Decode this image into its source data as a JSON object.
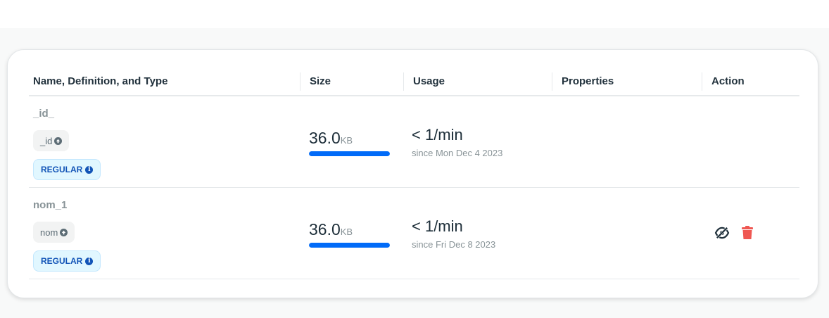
{
  "table": {
    "headers": [
      "Name, Definition, and Type",
      "Size",
      "Usage",
      "Properties",
      "Action"
    ],
    "rows": [
      {
        "name": "_id_",
        "field": "_id",
        "field_icon": "arrow-up-circle-icon",
        "type": "REGULAR",
        "type_icon": "info-icon",
        "size_value": "36.0",
        "size_unit": "KB",
        "size_fraction": 1.0,
        "usage": "< 1/min",
        "since": "since Mon Dec 4 2023",
        "actions": []
      },
      {
        "name": "nom_1",
        "field": "nom",
        "field_icon": "arrow-up-circle-icon",
        "type": "REGULAR",
        "type_icon": "info-icon",
        "size_value": "36.0",
        "size_unit": "KB",
        "size_fraction": 1.0,
        "usage": "< 1/min",
        "since": "since Fri Dec 8 2023",
        "actions": [
          "hide-icon",
          "trash-icon"
        ]
      }
    ]
  },
  "colors": {
    "accent_blue": "#016bf8",
    "badge_text": "#1254b7",
    "delete_red": "#ef5752",
    "hide_icon": "#1c2d38"
  }
}
